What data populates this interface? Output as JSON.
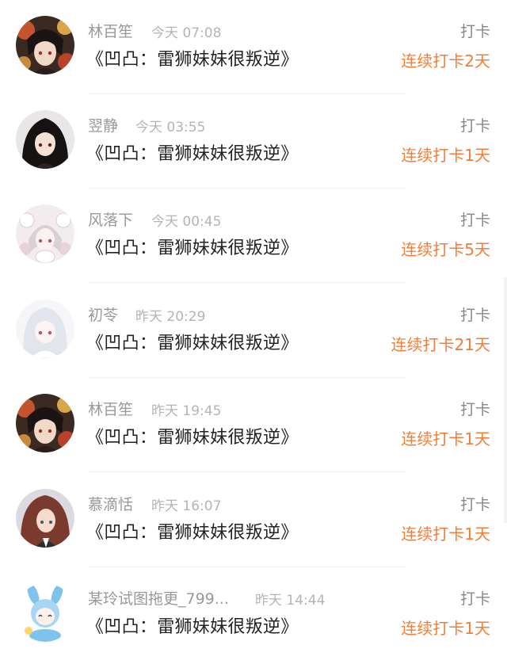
{
  "checkins": [
    {
      "user": "林百笙",
      "time": "今天 07:08",
      "book": "《凹凸：雷狮妹妹很叛逆》",
      "action": "打卡",
      "streak": "连续打卡2天",
      "avatar": "avatar-dark-hair-red-flowers"
    },
    {
      "user": "翌静",
      "time": "今天 03:55",
      "book": "《凹凸：雷狮妹妹很叛逆》",
      "action": "打卡",
      "streak": "连续打卡1天",
      "avatar": "avatar-dark-hair-girl"
    },
    {
      "user": "风落下",
      "time": "今天 00:45",
      "book": "《凹凸：雷狮妹妹很叛逆》",
      "action": "打卡",
      "streak": "连续打卡5天",
      "avatar": "avatar-pastel-bunny-girl"
    },
    {
      "user": "初苓",
      "time": "昨天 20:29",
      "book": "《凹凸：雷狮妹妹很叛逆》",
      "action": "打卡",
      "streak": "连续打卡21天",
      "avatar": "avatar-white-hair-girl"
    },
    {
      "user": "林百笙",
      "time": "昨天 19:45",
      "book": "《凹凸：雷狮妹妹很叛逆》",
      "action": "打卡",
      "streak": "连续打卡1天",
      "avatar": "avatar-dark-hair-red-flowers"
    },
    {
      "user": "慕滴恬",
      "time": "昨天 16:07",
      "book": "《凹凸：雷狮妹妹很叛逆》",
      "action": "打卡",
      "streak": "连续打卡1天",
      "avatar": "avatar-brown-hair-girl"
    },
    {
      "user": "某玲试图拖更_799...",
      "time": "昨天 14:44",
      "book": "《凹凸：雷狮妹妹很叛逆》",
      "action": "打卡",
      "streak": "连续打卡1天",
      "avatar": "avatar-chibi-blue-bunny"
    }
  ],
  "colors": {
    "streak": "#f37d36",
    "name": "#999999",
    "time": "#b4b4b4",
    "book": "#222222",
    "action": "#888888"
  }
}
